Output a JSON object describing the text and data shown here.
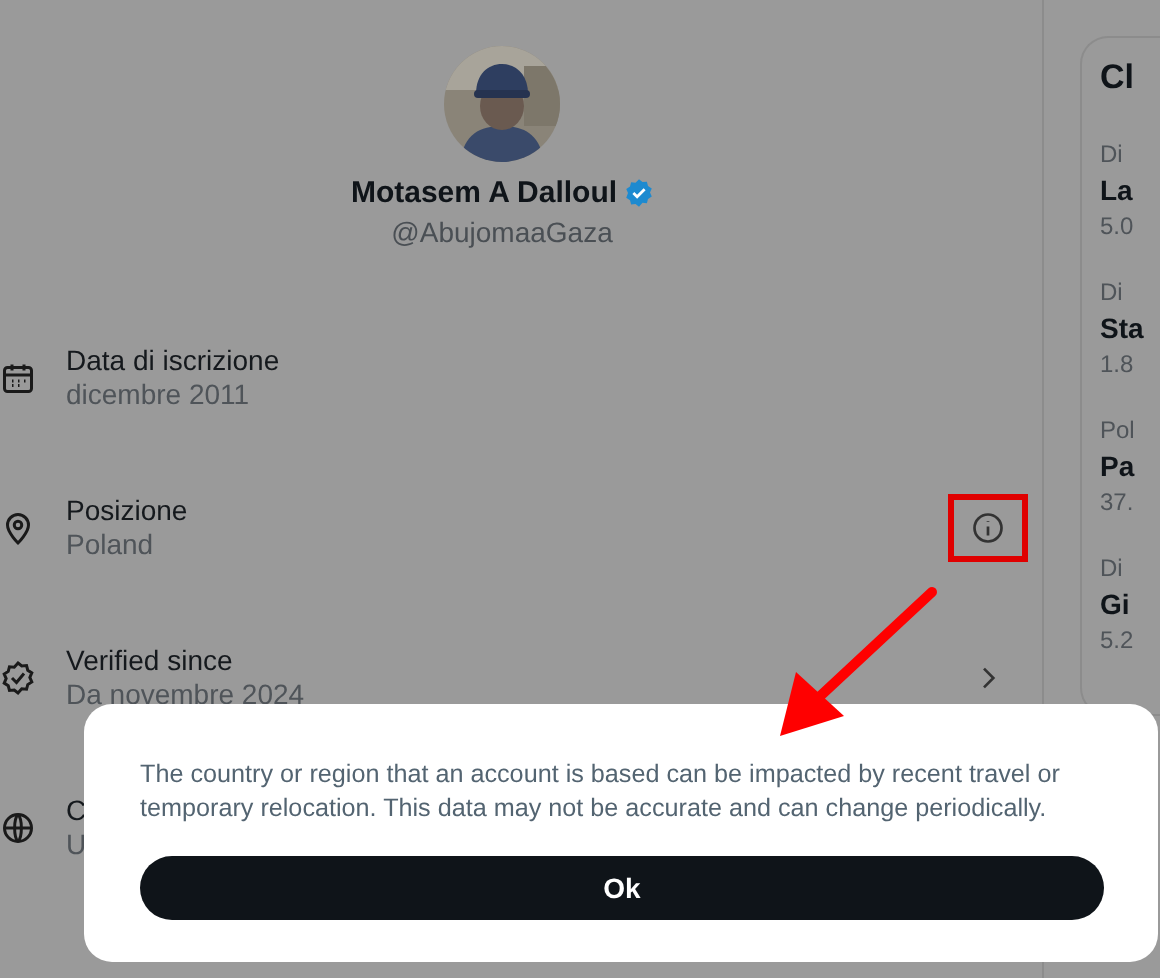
{
  "profile": {
    "name": "Motasem A Dalloul",
    "verified": true,
    "handle": "@AbujomaaGaza"
  },
  "details": [
    {
      "kind": "date",
      "label": "Data di iscrizione",
      "value": "dicembre 2011"
    },
    {
      "kind": "location",
      "label": "Posizione",
      "value": "Poland"
    },
    {
      "kind": "verified",
      "label": "Verified since",
      "value": "Da novembre 2024"
    },
    {
      "kind": "globe",
      "label": "C",
      "value": "U"
    }
  ],
  "sidebar": {
    "title": "Cl",
    "items": [
      {
        "context": "Di",
        "title": "La",
        "meta": "5.0"
      },
      {
        "context": "Di",
        "title": "Sta",
        "meta": "1.8"
      },
      {
        "context": "Pol",
        "title": "Pa",
        "meta": "37."
      },
      {
        "context": "Di",
        "title": "Gi",
        "meta": "5.2"
      }
    ]
  },
  "dialog": {
    "text": "The country or region that an account is based can be impacted by recent travel or temporary relocation. This data may not be accurate and can change periodically.",
    "button": "Ok"
  }
}
